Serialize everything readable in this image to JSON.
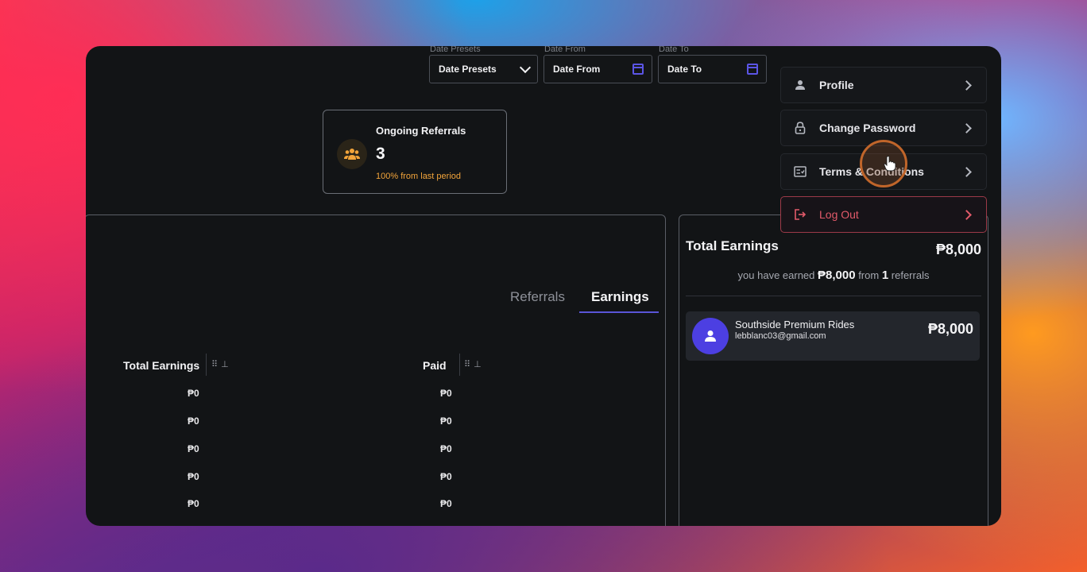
{
  "filters": {
    "presets": {
      "label": "Date Presets",
      "value": "Date Presets"
    },
    "from": {
      "label": "Date From",
      "value": "Date From"
    },
    "to": {
      "label": "Date To",
      "value": "Date To"
    }
  },
  "stat": {
    "title": "Ongoing Referrals",
    "value": "3",
    "change": "100% from last period",
    "accent": "#f2a43a"
  },
  "tabs": [
    {
      "label": "Referrals",
      "active": false
    },
    {
      "label": "Earnings",
      "active": true
    }
  ],
  "table": {
    "columns": [
      "Total Earnings",
      "Paid"
    ],
    "rows": [
      [
        "₱0",
        "₱0"
      ],
      [
        "₱0",
        "₱0"
      ],
      [
        "₱0",
        "₱0"
      ],
      [
        "₱0",
        "₱0"
      ],
      [
        "₱0",
        "₱0"
      ]
    ]
  },
  "earnings": {
    "title": "Total Earnings",
    "amount": "₱8,000",
    "summary_prefix": "you have earned",
    "summary_amount": "₱8,000",
    "summary_mid": "from",
    "summary_count": "1",
    "summary_suffix": "referrals",
    "referral": {
      "name": "Southside Premium Rides",
      "email": "lebblanc03@gmail.com",
      "amount": "₱8,000"
    }
  },
  "menu": {
    "items": [
      {
        "label": "Profile",
        "icon": "person-icon"
      },
      {
        "label": "Change Password",
        "icon": "lock-icon"
      },
      {
        "label": "Terms & Conditions",
        "icon": "document-icon"
      },
      {
        "label": "Log Out",
        "icon": "logout-icon"
      }
    ]
  },
  "colors": {
    "accent_purple": "#5a55d8",
    "logout_red": "#e25a6a",
    "avatar_purple": "#4c3fe2"
  }
}
